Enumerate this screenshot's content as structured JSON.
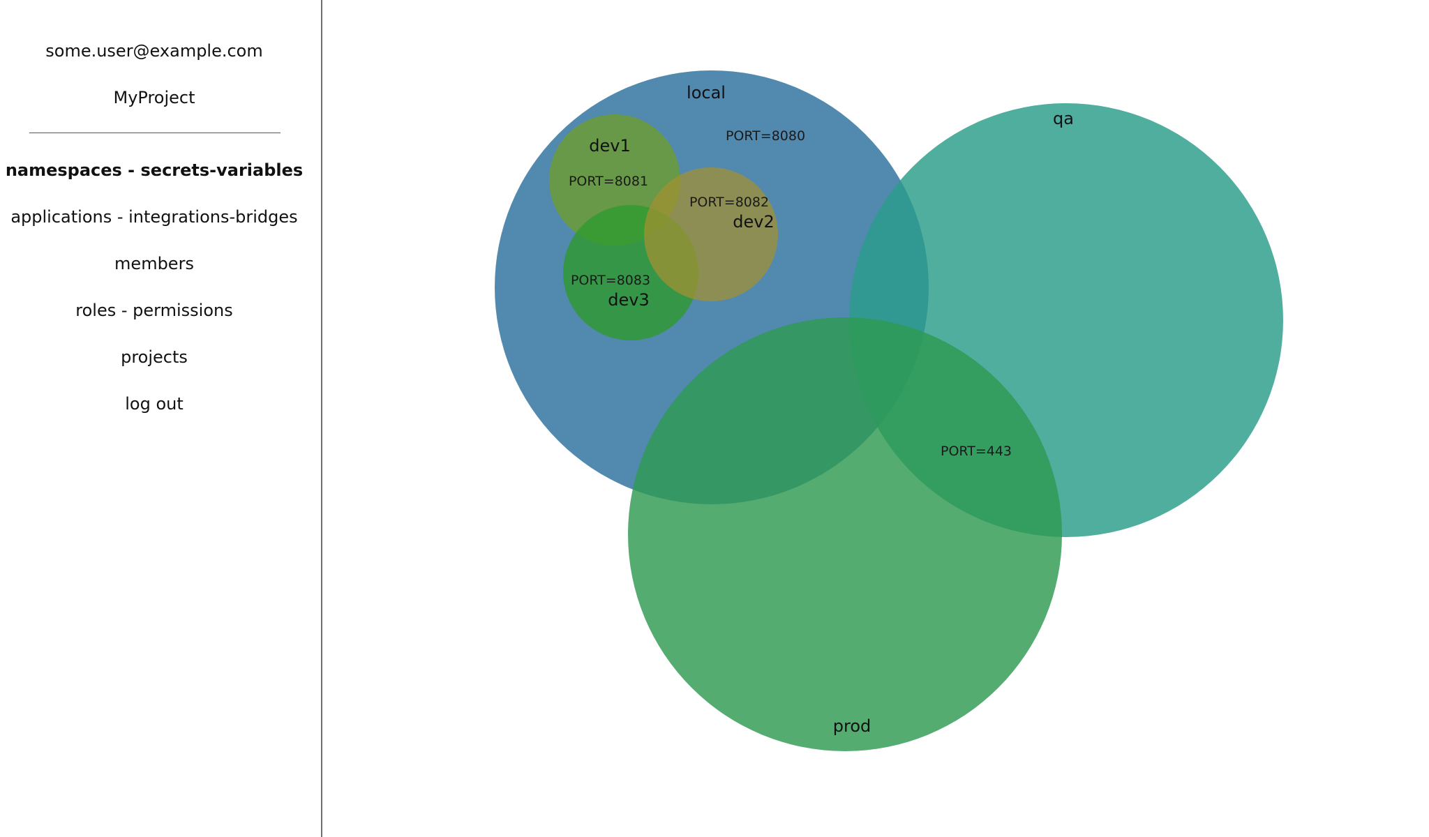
{
  "sidebar": {
    "user_email": "some.user@example.com",
    "project_name": "MyProject",
    "nav": [
      {
        "label": "namespaces - secrets-variables",
        "active": true
      },
      {
        "label": "applications - integrations-bridges",
        "active": false
      },
      {
        "label": "members",
        "active": false
      },
      {
        "label": "roles - permissions",
        "active": false
      },
      {
        "label": "projects",
        "active": false
      },
      {
        "label": "log out",
        "active": false
      }
    ]
  },
  "diagram": {
    "namespaces": [
      {
        "id": "local",
        "label": "local",
        "color": "#2c6f9e"
      },
      {
        "id": "qa",
        "label": "qa",
        "color": "#2a9c8a"
      },
      {
        "id": "prod",
        "label": "prod",
        "color": "#2e9a52"
      },
      {
        "id": "dev1",
        "label": "dev1",
        "color": "#6b9c36"
      },
      {
        "id": "dev2",
        "label": "dev2",
        "color": "#a39030"
      },
      {
        "id": "dev3",
        "label": "dev3",
        "color": "#2f9a2e"
      }
    ],
    "variables": [
      {
        "text": "PORT=8080",
        "namespace": "local"
      },
      {
        "text": "PORT=8081",
        "namespace": "dev1"
      },
      {
        "text": "PORT=8082",
        "namespace": "dev2"
      },
      {
        "text": "PORT=8083",
        "namespace": "dev3"
      },
      {
        "text": "PORT=443",
        "namespace": "qa ∩ prod"
      }
    ]
  }
}
